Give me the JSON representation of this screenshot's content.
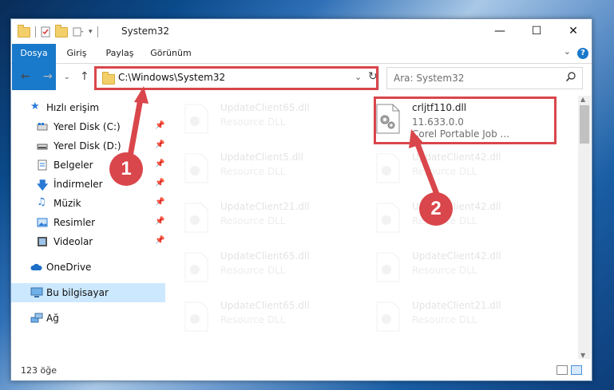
{
  "window": {
    "title": "System32"
  },
  "ribbon": {
    "tabs": [
      "Dosya",
      "Giriş",
      "Paylaş",
      "Görünüm"
    ],
    "help": "?"
  },
  "address": {
    "path": "C:\\Windows\\System32"
  },
  "search": {
    "placeholder": "Ara: System32"
  },
  "sidebar": {
    "items": [
      {
        "label": "Hızlı erişim"
      },
      {
        "label": "Yerel Disk (C:)"
      },
      {
        "label": "Yerel Disk (D:)"
      },
      {
        "label": "Belgeler"
      },
      {
        "label": "İndirmeler"
      },
      {
        "label": "Müzik"
      },
      {
        "label": "Resimler"
      },
      {
        "label": "Videolar"
      },
      {
        "label": "OneDrive"
      },
      {
        "label": "Bu bilgisayar"
      },
      {
        "label": "Ağ"
      }
    ]
  },
  "files": {
    "highlight": {
      "name": "crljtf110.dll",
      "version": "11.633.0.0",
      "description": "Corel Portable Job ..."
    },
    "left": [
      {
        "name": "UpdateClient65.dll",
        "type": "Resource DLL"
      },
      {
        "name": "UpdateClient5.dll",
        "type": "Resource DLL"
      },
      {
        "name": "UpdateClient21.dll",
        "type": "Resource DLL"
      },
      {
        "name": "UpdateClient65.dll",
        "type": "Resource DLL"
      },
      {
        "name": "UpdateClient65.dll",
        "type": "Resource DLL"
      }
    ],
    "right": [
      {
        "name": "UpdateClient42.dll",
        "type": "Resource DLL"
      },
      {
        "name": "UpdateClient42.dll",
        "type": "Resource DLL"
      },
      {
        "name": "UpdateClient42.dll",
        "type": "Resource DLL"
      },
      {
        "name": "UpdateClient21.dll",
        "type": "Resource DLL"
      }
    ]
  },
  "status": {
    "count": "123 öğe"
  },
  "annotations": {
    "step1": "1",
    "step2": "2",
    "color": "#d9464b"
  }
}
